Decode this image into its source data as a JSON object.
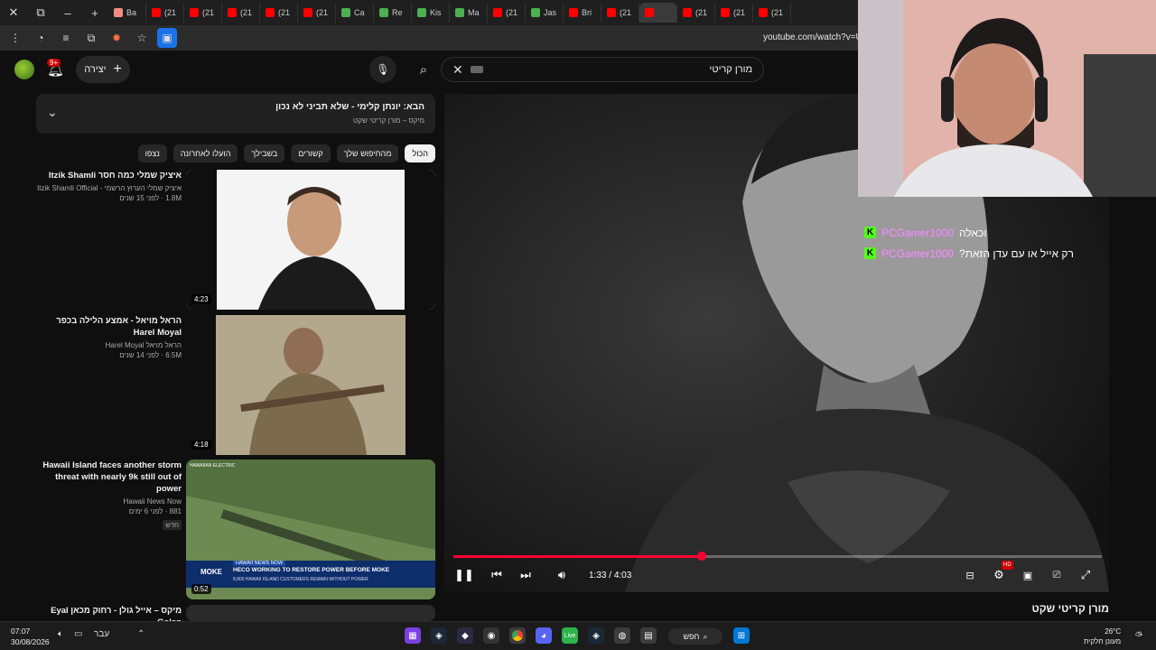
{
  "browser": {
    "tabs": [
      {
        "label": "Ba",
        "color": "#f28b82"
      },
      {
        "label": "(21",
        "color": "#ff0000"
      },
      {
        "label": "(21",
        "color": "#ff0000"
      },
      {
        "label": "(21",
        "color": "#ff0000"
      },
      {
        "label": "(21",
        "color": "#ff0000"
      },
      {
        "label": "(21",
        "color": "#ff0000"
      },
      {
        "label": "Ca",
        "color": "#4caf50"
      },
      {
        "label": "Re",
        "color": "#4caf50"
      },
      {
        "label": "Kis",
        "color": "#4caf50"
      },
      {
        "label": "Ma",
        "color": "#4caf50"
      },
      {
        "label": "(21",
        "color": "#ff0000"
      },
      {
        "label": "Jas",
        "color": "#4caf50"
      },
      {
        "label": "Bri",
        "color": "#ff0000"
      },
      {
        "label": "(21",
        "color": "#ff0000"
      },
      {
        "label": "",
        "color": "#ff0000",
        "active": true
      },
      {
        "label": "(21",
        "color": "#ff0000"
      },
      {
        "label": "(21",
        "color": "#ff0000"
      },
      {
        "label": "(21",
        "color": "#ff0000"
      }
    ],
    "url": "youtube.com/watch?v=Ul"
  },
  "youtube": {
    "notification_count": "9+",
    "create_label": "יצירה",
    "search_value": "מורן קריטי"
  },
  "up_next": {
    "title": "הבא: יונתן קלימי - שלא תביני לא נכון",
    "subtitle": "מיקס – מורן קריטי שקט"
  },
  "chips": [
    "הכול",
    "מהחיפוש שלך",
    "קשורים",
    "בשבילך",
    "הועלו לאחרונה",
    "נצפו"
  ],
  "recommendations": [
    {
      "title": "איציק שמלי כמה חסר Itzik Shamli",
      "channel": "איציק שמלי הערוץ הרשמי - Itzik Shamli Official",
      "stats": "1.8M ‏· לפני 15 שנים",
      "duration": "4:23",
      "badge": ""
    },
    {
      "title": "הראל מויאל - אמצע הלילה בכפר Harel Moyal",
      "channel": "הראל מויאל Harel Moyal",
      "stats": "6.5M ‏· לפני 14 שנים",
      "duration": "4:18",
      "badge": ""
    },
    {
      "title": "Hawaii Island faces another storm threat with nearly 9k still out of power",
      "channel": "Hawaii News Now",
      "stats": "881 ‏· לפני 6 ימים",
      "duration": "0:52",
      "badge": "חדש"
    },
    {
      "title": "מיקס – אייל גולן - רחוק מכאן Eyal Golan",
      "channel": "",
      "stats": "",
      "duration": "",
      "badge": ""
    }
  ],
  "thumb_texts": {
    "news_banner": "HAWAII NEWS NOW",
    "news_headline": "HECO WORKING TO RESTORE POWER BEFORE MOKE",
    "news_sub": "8,800 HAWAII ISLAND CUSTOMERS REMAIN WITHOUT POWER",
    "news_logo": "MOKE",
    "news_corner": "HAWAIIAN ELECTRIC"
  },
  "player": {
    "current_time": "1:33",
    "duration": "4:03",
    "progress_fraction": 0.383,
    "video_title": "מורן קריטי שקט",
    "hd_badge": "HD"
  },
  "chat": [
    {
      "user": "PCGamer1000",
      "message": "וכאלה"
    },
    {
      "user": "PCGamer1000",
      "message": "?רק אייל או עם עדן הזאת"
    }
  ],
  "taskbar": {
    "time": "07:07",
    "date": "30/08/2026",
    "language": "עבר",
    "search_label": "חפש",
    "temperature": "26°C",
    "weather_desc": "מעונן חלקית"
  },
  "colors": {
    "accent_red": "#ff0033",
    "kick_green": "#53fc18",
    "chat_user": "#c9a0ff"
  }
}
